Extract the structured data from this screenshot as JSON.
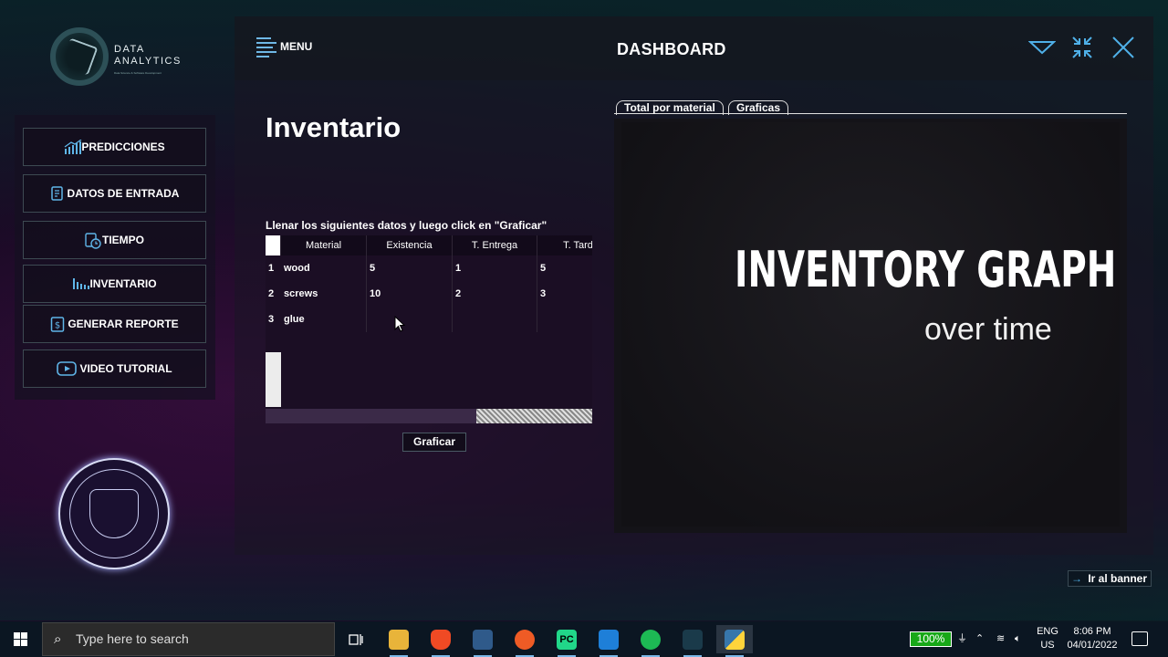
{
  "logo": {
    "line1": "DATA",
    "line2": "ANALYTICS",
    "tagline": "Data Science & Software Development"
  },
  "sidebar": {
    "items": [
      {
        "label": "PREDICCIONES",
        "icon": "chart-icon"
      },
      {
        "label": "DATOS DE ENTRADA",
        "icon": "document-icon"
      },
      {
        "label": "TIEMPO",
        "icon": "clock-icon"
      },
      {
        "label": "INVENTARIO",
        "icon": "inventory-icon"
      },
      {
        "label": "GENERAR REPORTE",
        "icon": "report-icon"
      },
      {
        "label": "VIDEO TUTORIAL",
        "icon": "video-icon"
      }
    ]
  },
  "header": {
    "menu_label": "MENU",
    "title": "DASHBOARD"
  },
  "main": {
    "title": "Inventario",
    "instruction": "Llenar los siguientes datos y luego click en \"Graficar\"",
    "table": {
      "columns": [
        "Material",
        "Existencia",
        "T. Entrega",
        "T. Tard"
      ],
      "rows": [
        {
          "index": "1",
          "cells": [
            "wood",
            "5",
            "1",
            "5"
          ]
        },
        {
          "index": "2",
          "cells": [
            "screws",
            "10",
            "2",
            "3"
          ]
        },
        {
          "index": "3",
          "cells": [
            "glue",
            "",
            "",
            ""
          ]
        }
      ]
    },
    "graficar_label": "Graficar"
  },
  "graph_panel": {
    "tabs": [
      "Total por material",
      "Graficas"
    ],
    "active_tab": "Graficas",
    "title": "INVENTORY GRAPH",
    "subtitle": "over time"
  },
  "banner_link": "Ir al banner",
  "taskbar": {
    "search_placeholder": "Type here to search",
    "battery": "100%",
    "lang_line1": "ENG",
    "lang_line2": "US",
    "time": "8:06 PM",
    "date": "04/01/2022"
  },
  "colors": {
    "accent": "#4fb0e8",
    "panel": "#141318",
    "battery": "#18a818"
  }
}
